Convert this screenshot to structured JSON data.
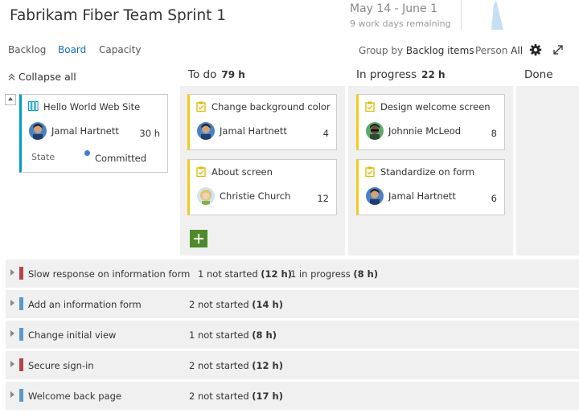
{
  "header": {
    "title": "Fabrikam Fiber Team Sprint 1",
    "dates": "May 14 - June 1",
    "work_days": "9 work days remaining"
  },
  "hub_tabs": [
    {
      "label": "Backlog"
    },
    {
      "label": "Board",
      "selected": true
    },
    {
      "label": "Capacity"
    }
  ],
  "options": {
    "group_by_label": "Group by",
    "group_by_value": "Backlog items",
    "person_label": "Person",
    "person_value": "All"
  },
  "board": {
    "collapse_all": "Collapse all",
    "columns": [
      {
        "name": "To do",
        "count": "79 h"
      },
      {
        "name": "In progress",
        "count": "22 h"
      },
      {
        "name": "Done",
        "count": ""
      }
    ],
    "parent_card": {
      "title": "Hello World Web Site",
      "assignee": "Jamal Hartnett",
      "hours": "30 h",
      "state_label": "State",
      "state_value": "Committed"
    },
    "todo_cards": [
      {
        "title": "Change background color",
        "assignee": "Jamal Hartnett",
        "hours": "4"
      },
      {
        "title": "About screen",
        "assignee": "Christie Church",
        "hours": "12"
      }
    ],
    "inprogress_cards": [
      {
        "title": "Design welcome screen",
        "assignee": "Johnnie McLeod",
        "hours": "8"
      },
      {
        "title": "Standardize on form",
        "assignee": "Jamal Hartnett",
        "hours": "6"
      }
    ],
    "rows": [
      {
        "title": "Slow response on information form",
        "type": "bug",
        "s1": "1 not started",
        "h1": "(12 h)",
        "s2": "1 in progress",
        "h2": "(8 h)"
      },
      {
        "title": "Add an information form",
        "type": "pbi",
        "s1": "2 not started",
        "h1": "(14 h)"
      },
      {
        "title": "Change initial view",
        "type": "pbi",
        "s1": "1 not started",
        "h1": "(8 h)"
      },
      {
        "title": "Secure sign-in",
        "type": "bug",
        "s1": "2 not started",
        "h1": "(12 h)"
      },
      {
        "title": "Welcome back page",
        "type": "pbi",
        "s1": "2 not started",
        "h1": "(17 h)"
      }
    ]
  },
  "colors": {
    "bug": "#b4434a",
    "pbi": "#5b98c8",
    "task": "#f2cb1d",
    "committed": "#3d7bd9",
    "add_button": "#4e8a2b"
  },
  "icons": [
    "backlog-item-icon",
    "task-icon",
    "gear-icon",
    "expand-icon",
    "collapse-all-icon",
    "add-icon"
  ]
}
